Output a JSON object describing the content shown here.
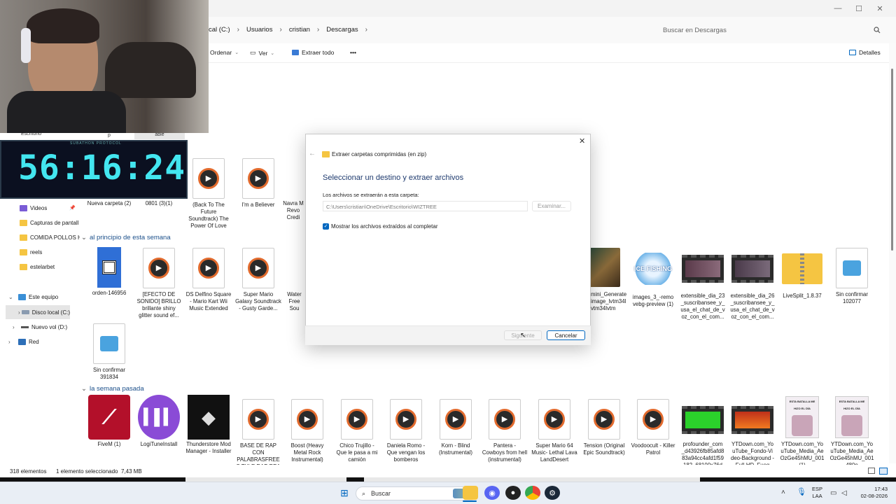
{
  "window": {
    "min": "—",
    "max": "☐",
    "close": "✕"
  },
  "address": {
    "crumbs": [
      "cal (C:)",
      "Usuarios",
      "cristian",
      "Descargas"
    ],
    "search_placeholder": "Buscar en Descargas"
  },
  "commands": {
    "sort": "Ordenar",
    "view": "Ver",
    "extract_all": "Extraer todo",
    "more": "•••",
    "details": "Detalles"
  },
  "nav": {
    "partial_top_1": "Escritorio",
    "partial_top_2": "p",
    "partial_top_3": "able",
    "items": [
      "Videos",
      "Capturas de pantall",
      "COMIDA POLLOS H",
      "reels",
      "estelarbet",
      "Este equipo",
      "Disco local (C:)",
      "Nuevo vol (D:)",
      "Red"
    ]
  },
  "timer": {
    "value": "56:16:24",
    "subtitle": "SUBATHON PROTOCOL"
  },
  "groups": {
    "early_week": "al principio de esta semana",
    "last_week": "la semana pasada"
  },
  "row1": [
    "Nueva carpeta (2)",
    "0801 (3)(1)",
    "(Back To The Future Soundtrack) The Power Of Love",
    "I'm a Believer",
    "Navra M Revo Credi"
  ],
  "row2": [
    "orden-146956",
    "[EFECTO DE SONIDO] BRILLO brillante shiny glitter sound ef...",
    "DS Delfino Square - Mario Kart Wii Music Extended",
    "Super Mario Galaxy Soundtrack - Gusty Garde...",
    "Water Free Sou"
  ],
  "row2_right": [
    "mini_Generate image_lvtm34l vtm34lvtm",
    "images_3_-remo vebg-preview (1)",
    "extensible_dia_23 _suscribansee_y_ usa_el_chat_de_v oz_con_el_com...",
    "extensible_dia_26 _suscribansee_y_ usa_el_chat_de_v oz_con_el_com...",
    "LiveSplit_1.8.37",
    "Sin confirmar 102077"
  ],
  "row3": [
    "Sin confirmar 391834"
  ],
  "row4": [
    "FiveM (1)",
    "LogiTuneInstall",
    "Thunderstore Mod Manager - Installer",
    "BASE DE RAP CON PALABRASFREES TYLE RAP REA",
    "Boost (Heavy Metal Rock Instrumental)",
    "Chico Trujillo - Que le pasa a mi camión",
    "Daniela Romo - Que vengan los bomberos",
    "Korn - Blind (Instrumental)",
    "Pantera - Cowboys from hell (instrumental)",
    "Super Mario 64 Music- Lethal Lava LandDesert",
    "Tension (Original Epic Soundtrack)",
    "Voodoocult - Killer Patrol",
    "profounder_com _d43926fb85afd8 83a94cc4afd1f59 182_68100x76d",
    "YTDown.com_Yo uTube_Fondo-Vi deo-Background -Full-HD_Fueg",
    "YTDown.com_Yo uTube_Media_Ae OzGe45hMU_001 (1)",
    "YTDown.com_Yo uTube_Media_Ae OzGe45hMU_001 480p"
  ],
  "thumb_text": {
    "ice": "ICE FISHING",
    "battle": "ESTA BATALLA ME HIZO EL DÍA"
  },
  "dialog": {
    "header": "Extraer carpetas comprimidas (en zip)",
    "title": "Seleccionar un destino y extraer archivos",
    "dest_label": "Los archivos se extraerán a esta carpeta:",
    "dest_value": "C:\\Users\\cristian\\OneDrive\\Escritorio\\WIZTREE",
    "browse": "Examinar...",
    "show_files": "Mostrar los archivos extraídos al completar",
    "next": "Siguiente",
    "cancel": "Cancelar"
  },
  "status": {
    "count": "318 elementos",
    "selected": "1 elemento seleccionado  7,43 MB"
  },
  "taskbar": {
    "search": "Buscar",
    "lang": "ESP",
    "layout": "LAA",
    "time": "17:43",
    "date": "02-08-2026"
  },
  "colors": {
    "accent": "#0067c0",
    "timer": "#43e6f0",
    "folder": "#f5c542"
  }
}
